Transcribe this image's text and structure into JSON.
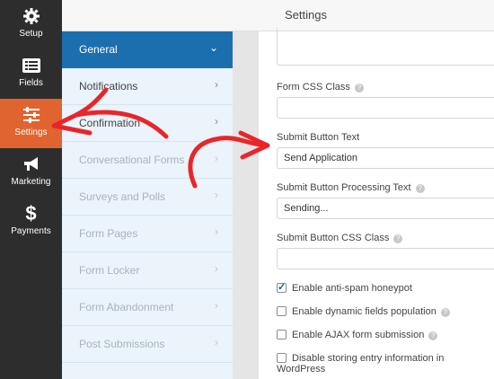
{
  "rail": {
    "items": [
      {
        "label": "Setup",
        "icon": "gear-icon"
      },
      {
        "label": "Fields",
        "icon": "fields-list-icon"
      },
      {
        "label": "Settings",
        "icon": "sliders-icon",
        "active": true
      },
      {
        "label": "Marketing",
        "icon": "megaphone-icon"
      },
      {
        "label": "Payments",
        "icon": "dollar-icon"
      }
    ]
  },
  "header": {
    "title": "Settings"
  },
  "nav": {
    "items": [
      {
        "label": "General",
        "chevron": "⌄",
        "active": true
      },
      {
        "label": "Notifications",
        "chevron": "›"
      },
      {
        "label": "Confirmation",
        "chevron": "›"
      },
      {
        "label": "Conversational Forms",
        "chevron": "›",
        "disabled": true
      },
      {
        "label": "Surveys and Polls",
        "chevron": "›",
        "disabled": true
      },
      {
        "label": "Form Pages",
        "chevron": "›",
        "disabled": true
      },
      {
        "label": "Form Locker",
        "chevron": "›",
        "disabled": true
      },
      {
        "label": "Form Abandonment",
        "chevron": "›",
        "disabled": true
      },
      {
        "label": "Post Submissions",
        "chevron": "›",
        "disabled": true
      }
    ]
  },
  "form": {
    "css_class_label": "Form CSS Class",
    "css_class_value": "",
    "submit_text_label": "Submit Button Text",
    "submit_text_value": "Send Application",
    "processing_label": "Submit Button Processing Text",
    "processing_value": "Sending...",
    "submit_css_label": "Submit Button CSS Class",
    "submit_css_value": "",
    "checkboxes": [
      {
        "label": "Enable anti-spam honeypot",
        "checked": true,
        "help": false
      },
      {
        "label": "Enable dynamic fields population",
        "checked": false,
        "help": true
      },
      {
        "label": "Enable AJAX form submission",
        "checked": false,
        "help": true
      },
      {
        "label": "Disable storing entry information in WordPress",
        "checked": false,
        "help": false
      }
    ],
    "help_glyph": "?"
  },
  "colors": {
    "rail_bg": "#2d2d2d",
    "rail_active": "#e0642f",
    "nav_bg": "#ebf3fb",
    "nav_active": "#1c6faf",
    "annotation": "#e8262a"
  }
}
